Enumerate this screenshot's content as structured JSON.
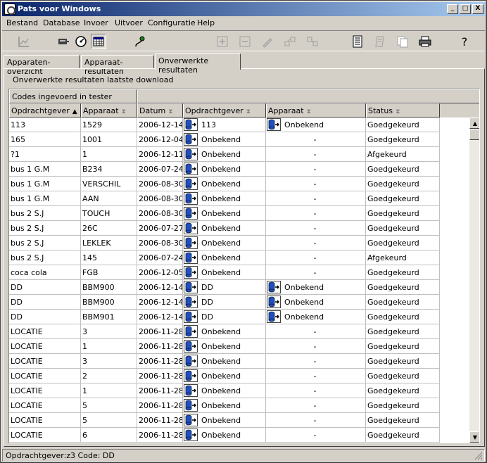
{
  "window": {
    "title": "Pats voor Windows",
    "min_label": "_",
    "max_label": "□",
    "close_label": "X"
  },
  "menu": [
    {
      "label": "Bestand"
    },
    {
      "label": "Database"
    },
    {
      "label": "Invoer"
    },
    {
      "label": "Uitvoer"
    },
    {
      "label": "Configuratie"
    },
    {
      "label": "Help"
    }
  ],
  "toolbar": {
    "help_label": "?"
  },
  "tabs": [
    {
      "label": "Apparaten-overzicht"
    },
    {
      "label": "Apparaat-resultaten"
    },
    {
      "label": "Onverwerkte resultaten"
    }
  ],
  "panel": {
    "label": "Onverwerkte resultaten laatste download",
    "band_label": "Codes ingevoerd in tester"
  },
  "columns": [
    {
      "label": "Opdrachtgever",
      "sort": "▲"
    },
    {
      "label": "Apparaat",
      "sort": "⧗"
    },
    {
      "label": "Datum",
      "sort": "⧗"
    },
    {
      "label": "Opdrachtgever",
      "sort": "⧗"
    },
    {
      "label": "Apparaat",
      "sort": "⧗"
    },
    {
      "label": "Status",
      "sort": "⧗"
    }
  ],
  "rows": [
    {
      "og": "113",
      "app": "1529",
      "datum": "2006-12-14",
      "og2": "113",
      "app2": "Onbekend",
      "status": "Goedgekeurd"
    },
    {
      "og": "165",
      "app": "1001",
      "datum": "2006-12-04",
      "og2": "Onbekend",
      "app2": "-",
      "status": "Goedgekeurd"
    },
    {
      "og": "?1",
      "app": "1",
      "datum": "2006-12-11",
      "og2": "Onbekend",
      "app2": "-",
      "status": "Afgekeurd"
    },
    {
      "og": "bus 1 G.M",
      "app": "B234",
      "datum": "2006-07-24",
      "og2": "Onbekend",
      "app2": "-",
      "status": "Goedgekeurd"
    },
    {
      "og": "bus 1 G.M",
      "app": "VERSCHIL",
      "datum": "2006-08-30",
      "og2": "Onbekend",
      "app2": "-",
      "status": "Goedgekeurd"
    },
    {
      "og": "bus 1 G.M",
      "app": "AAN",
      "datum": "2006-08-30",
      "og2": "Onbekend",
      "app2": "-",
      "status": "Goedgekeurd"
    },
    {
      "og": "bus 2 S.J",
      "app": "TOUCH",
      "datum": "2006-08-30",
      "og2": "Onbekend",
      "app2": "-",
      "status": "Goedgekeurd"
    },
    {
      "og": "bus 2 S.J",
      "app": "26C",
      "datum": "2006-07-27",
      "og2": "Onbekend",
      "app2": "-",
      "status": "Goedgekeurd"
    },
    {
      "og": "bus 2 S.J",
      "app": "LEKLEK",
      "datum": "2006-08-30",
      "og2": "Onbekend",
      "app2": "-",
      "status": "Goedgekeurd"
    },
    {
      "og": "bus 2 S.J",
      "app": "145",
      "datum": "2006-07-24",
      "og2": "Onbekend",
      "app2": "-",
      "status": "Afgekeurd"
    },
    {
      "og": "coca cola",
      "app": "FGB",
      "datum": "2006-12-05",
      "og2": "Onbekend",
      "app2": "-",
      "status": "Goedgekeurd"
    },
    {
      "og": "DD",
      "app": "BBM900",
      "datum": "2006-12-14",
      "og2": "DD",
      "app2": "Onbekend",
      "status": "Goedgekeurd"
    },
    {
      "og": "DD",
      "app": "BBM900",
      "datum": "2006-12-14",
      "og2": "DD",
      "app2": "Onbekend",
      "status": "Goedgekeurd"
    },
    {
      "og": "DD",
      "app": "BBM901",
      "datum": "2006-12-14",
      "og2": "DD",
      "app2": "Onbekend",
      "status": "Goedgekeurd"
    },
    {
      "og": "LOCATIE",
      "app": "3",
      "datum": "2006-11-28",
      "og2": "Onbekend",
      "app2": "-",
      "status": "Goedgekeurd"
    },
    {
      "og": "LOCATIE",
      "app": "1",
      "datum": "2006-11-28",
      "og2": "Onbekend",
      "app2": "-",
      "status": "Goedgekeurd"
    },
    {
      "og": "LOCATIE",
      "app": "3",
      "datum": "2006-11-28",
      "og2": "Onbekend",
      "app2": "-",
      "status": "Goedgekeurd"
    },
    {
      "og": "LOCATIE",
      "app": "2",
      "datum": "2006-11-28",
      "og2": "Onbekend",
      "app2": "-",
      "status": "Goedgekeurd"
    },
    {
      "og": "LOCATIE",
      "app": "1",
      "datum": "2006-11-28",
      "og2": "Onbekend",
      "app2": "-",
      "status": "Goedgekeurd"
    },
    {
      "og": "LOCATIE",
      "app": "5",
      "datum": "2006-11-28",
      "og2": "Onbekend",
      "app2": "-",
      "status": "Goedgekeurd"
    },
    {
      "og": "LOCATIE",
      "app": "5",
      "datum": "2006-11-28",
      "og2": "Onbekend",
      "app2": "-",
      "status": "Goedgekeurd"
    },
    {
      "og": "LOCATIE",
      "app": "6",
      "datum": "2006-11-28",
      "og2": "Onbekend",
      "app2": "-",
      "status": "Goedgekeurd"
    }
  ],
  "status_bar": {
    "text": "Opdrachtgever:z3  Code: DD"
  }
}
